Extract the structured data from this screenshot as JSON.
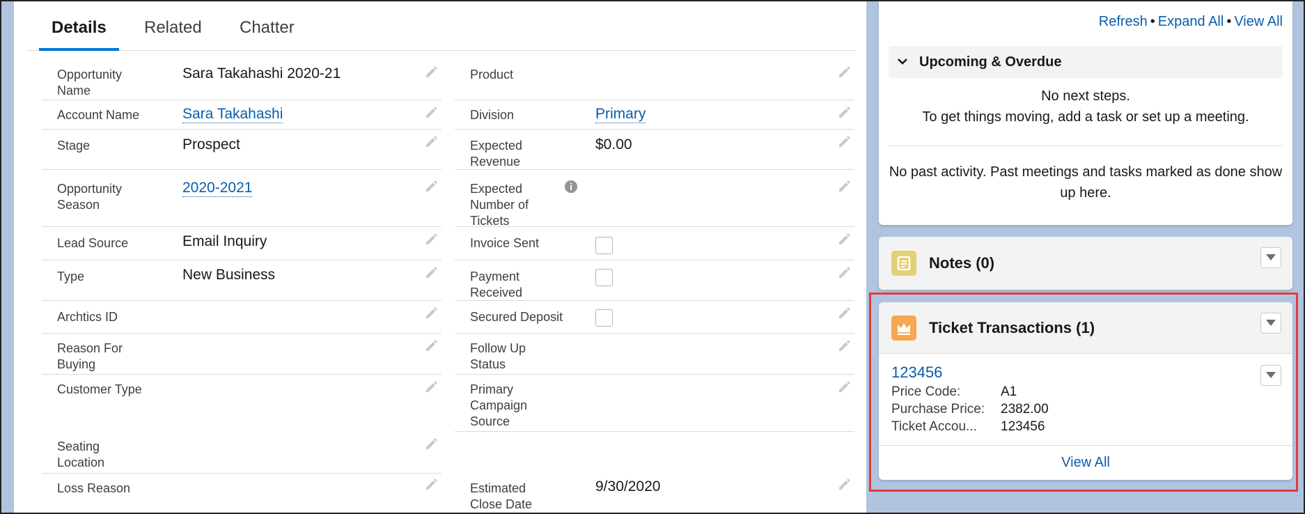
{
  "tabs": [
    {
      "label": "Details"
    },
    {
      "label": "Related"
    },
    {
      "label": "Chatter"
    }
  ],
  "fields_left": [
    {
      "label": "Opportunity Name",
      "value": "Sara Takahashi 2020-21",
      "link": false
    },
    {
      "label": "Account Name",
      "value": "Sara Takahashi",
      "link": true
    },
    {
      "label": "Stage",
      "value": "Prospect",
      "link": false
    },
    {
      "label": "Opportunity Season",
      "value": "2020-2021",
      "link": true
    },
    {
      "label": "Lead Source",
      "value": "Email Inquiry",
      "link": false
    },
    {
      "label": "Type",
      "value": "New Business",
      "link": false
    },
    {
      "label": "Archtics ID",
      "value": "",
      "link": false
    },
    {
      "label": "Reason For Buying",
      "value": "",
      "link": false
    },
    {
      "label": "Customer Type",
      "value": "",
      "link": false
    },
    {
      "label": "Seating Location",
      "value": "",
      "link": false
    },
    {
      "label": "Loss Reason",
      "value": "",
      "link": false
    }
  ],
  "fields_right": [
    {
      "label": "Product",
      "value": ""
    },
    {
      "label": "Division",
      "value": "Primary",
      "link": true
    },
    {
      "label": "Expected Revenue",
      "value": "$0.00"
    },
    {
      "label": "Expected Number of Tickets",
      "value": "",
      "info": true
    },
    {
      "label": "Invoice Sent",
      "checkbox": true,
      "checked": false
    },
    {
      "label": "Payment Received",
      "checkbox": true,
      "checked": false
    },
    {
      "label": "Secured Deposit",
      "checkbox": true,
      "checked": false
    },
    {
      "label": "Follow Up Status",
      "value": ""
    },
    {
      "label": "Primary Campaign Source",
      "value": ""
    },
    {
      "label": "Estimated Close Date",
      "value": "9/30/2020"
    }
  ],
  "activity": {
    "links": {
      "refresh": "Refresh",
      "expand_all": "Expand All",
      "view_all": "View All"
    },
    "upcoming_title": "Upcoming & Overdue",
    "no_next_steps": "No next steps.",
    "get_moving": "To get things moving, add a task or set up a meeting.",
    "no_past_line1": "No past activity. Past meetings and tasks marked as done show",
    "no_past_line2": "up here."
  },
  "notes_card": {
    "title": "Notes (0)",
    "icon": "notes-icon",
    "color": "#e3d076"
  },
  "tickets_card": {
    "title": "Ticket Transactions (1)",
    "icon": "crown-icon",
    "color": "#f4a850",
    "record": {
      "id": "123456",
      "rows": [
        {
          "k": "Price Code:",
          "v": "A1"
        },
        {
          "k": "Purchase Price:",
          "v": "2382.00"
        },
        {
          "k": "Ticket Accou...",
          "v": "123456"
        }
      ]
    },
    "footer": "View All"
  },
  "colors": {
    "link": "#0b5cab",
    "tab_active": "#0176d3",
    "highlight": "#e23b3b",
    "background": "#b0c4df"
  }
}
